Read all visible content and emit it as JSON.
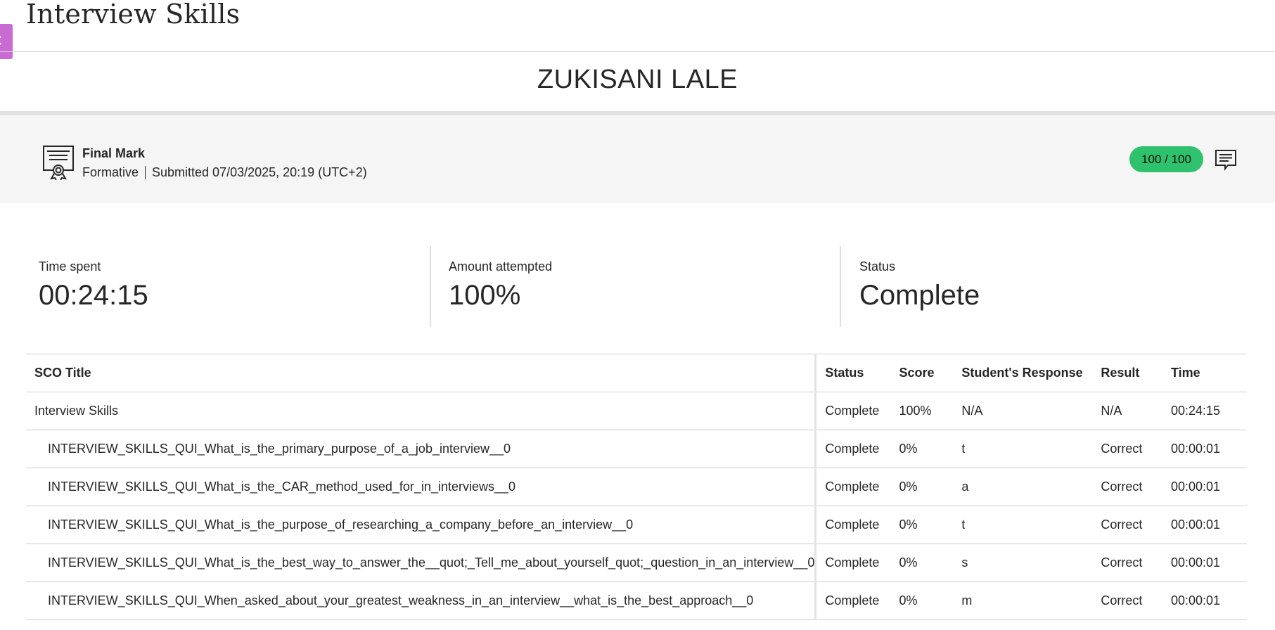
{
  "header": {
    "course_title": "Interview Skills",
    "student_name": "ZUKISANI LALE"
  },
  "grade": {
    "label": "Final Mark",
    "type": "Formative",
    "submitted": "Submitted 07/03/2025, 20:19 (UTC+2)",
    "score": "100 / 100",
    "score_color": "#2dc26b"
  },
  "stats": {
    "time_spent_label": "Time spent",
    "time_spent_value": "00:24:15",
    "amount_label": "Amount attempted",
    "amount_value": "100%",
    "status_label": "Status",
    "status_value": "Complete"
  },
  "table": {
    "columns": {
      "title": "SCO Title",
      "status": "Status",
      "score": "Score",
      "response": "Student's Response",
      "result": "Result",
      "time": "Time"
    },
    "rows": [
      {
        "title": "Interview Skills",
        "status": "Complete",
        "score": "100%",
        "response": "N/A",
        "result": "N/A",
        "time": "00:24:15"
      },
      {
        "title": "INTERVIEW_SKILLS_QUI_What_is_the_primary_purpose_of_a_job_interview__0",
        "status": "Complete",
        "score": "0%",
        "response": "t",
        "result": "Correct",
        "time": "00:00:01"
      },
      {
        "title": "INTERVIEW_SKILLS_QUI_What_is_the_CAR_method_used_for_in_interviews__0",
        "status": "Complete",
        "score": "0%",
        "response": "a",
        "result": "Correct",
        "time": "00:00:01"
      },
      {
        "title": "INTERVIEW_SKILLS_QUI_What_is_the_purpose_of_researching_a_company_before_an_interview__0",
        "status": "Complete",
        "score": "0%",
        "response": "t",
        "result": "Correct",
        "time": "00:00:01"
      },
      {
        "title": "INTERVIEW_SKILLS_QUI_What_is_the_best_way_to_answer_the__quot;_Tell_me_about_yourself_quot;_question_in_an_interview__0",
        "status": "Complete",
        "score": "0%",
        "response": "s",
        "result": "Correct",
        "time": "00:00:01"
      },
      {
        "title": "INTERVIEW_SKILLS_QUI_When_asked_about_your_greatest_weakness_in_an_interview__what_is_the_best_approach__0",
        "status": "Complete",
        "score": "0%",
        "response": "m",
        "result": "Correct",
        "time": "00:00:01"
      }
    ]
  },
  "icons": {
    "collapse": "chevron-left-icon",
    "certificate": "certificate-icon",
    "feedback": "feedback-icon"
  }
}
